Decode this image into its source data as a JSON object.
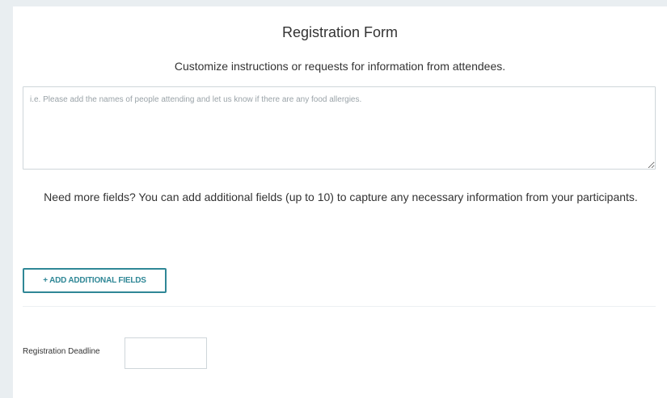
{
  "form": {
    "title": "Registration Form",
    "subtitle": "Customize instructions or requests for information from attendees.",
    "instructions_placeholder": "i.e. Please add the names of people attending and let us know if there are any food allergies.",
    "instructions_value": "",
    "more_fields_text": "Need more fields? You can add additional fields (up to 10) to capture any necessary information from your participants.",
    "add_fields_label": "+ ADD ADDITIONAL FIELDS",
    "deadline_label": "Registration Deadline",
    "deadline_value": ""
  },
  "colors": {
    "page_background": "#e9eef1",
    "card_background": "#ffffff",
    "accent": "#2f8796",
    "border": "#cfd6da",
    "text": "#333333",
    "placeholder": "#9aa3a8"
  }
}
